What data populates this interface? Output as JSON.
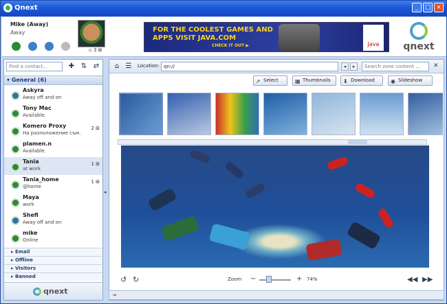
{
  "app": {
    "title": "Qnext"
  },
  "window_controls": {
    "minimize": "_",
    "maximize": "□",
    "close": "×"
  },
  "user": {
    "name": "Mike  (Away)",
    "status": "Away",
    "avatar_badge": "3"
  },
  "ad": {
    "headline": "FOR THE COOLEST GAMES AND APPS VISIT JAVA.COM",
    "cta": "CHECK IT OUT ▶",
    "logo_text": "Java"
  },
  "brand": {
    "wordmark": "qnext"
  },
  "contacts_panel": {
    "search_placeholder": "Find a contact...",
    "group": {
      "label": "General (6)"
    },
    "contacts": [
      {
        "name": "Askyra",
        "status": "Away off and on",
        "count": "",
        "icon": "away-status-icon"
      },
      {
        "name": "Tony Mac",
        "status": "Available.",
        "count": "",
        "icon": "online-status-icon"
      },
      {
        "name": "Komero Proxy",
        "status": "На разположение съм.",
        "count": "2",
        "icon": "online-status-icon"
      },
      {
        "name": "plamen.n",
        "status": "Available.",
        "count": "",
        "icon": "online-status-icon"
      },
      {
        "name": "Tania",
        "status": "at work",
        "count": "1",
        "icon": "online-status-icon"
      },
      {
        "name": "Tania_home",
        "status": "@home",
        "count": "1",
        "icon": "online-status-icon"
      },
      {
        "name": "Maya",
        "status": "work",
        "count": "",
        "icon": "online-status-icon"
      },
      {
        "name": "Shefi",
        "status": "Away off and on",
        "count": "",
        "icon": "away-status-icon"
      },
      {
        "name": "mike",
        "status": "Online",
        "count": "",
        "icon": "online-status-icon"
      }
    ],
    "sub_groups": [
      "Email",
      "Offline",
      "Visitors",
      "Banned"
    ]
  },
  "browser": {
    "location_label": "Location:",
    "location_value": "qn://",
    "search_placeholder": "Search zone content ...",
    "actions": {
      "select": "Select",
      "thumbnails": "Thumbnails",
      "download": "Download",
      "slideshow": "Slideshow"
    },
    "zoom": {
      "label": "Zoom",
      "value": "74%",
      "level": 0.3
    },
    "thumbnail_colors": [
      "#2c5a9e",
      "#3460b0",
      "#c9302c",
      "#1f5da8",
      "#8fb6d9",
      "#6a9cd2",
      "#325f9f"
    ]
  }
}
